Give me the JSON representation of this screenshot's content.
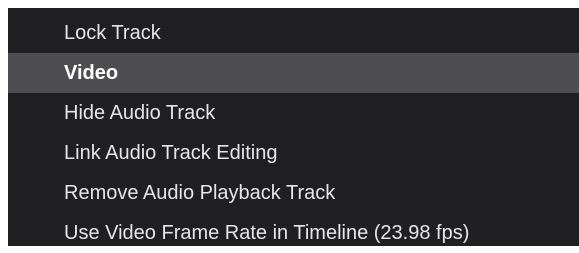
{
  "menu": {
    "items": [
      {
        "label": "Lock Track"
      },
      {
        "label": "Video"
      },
      {
        "label": "Hide Audio Track"
      },
      {
        "label": "Link Audio Track Editing"
      },
      {
        "label": "Remove Audio Playback Track"
      },
      {
        "label": "Use Video Frame Rate in Timeline (23.98 fps)"
      }
    ],
    "selected_index": 1,
    "colors": {
      "background": "#202022",
      "highlight": "#4e4e52",
      "text": "#e6e6e6"
    }
  }
}
